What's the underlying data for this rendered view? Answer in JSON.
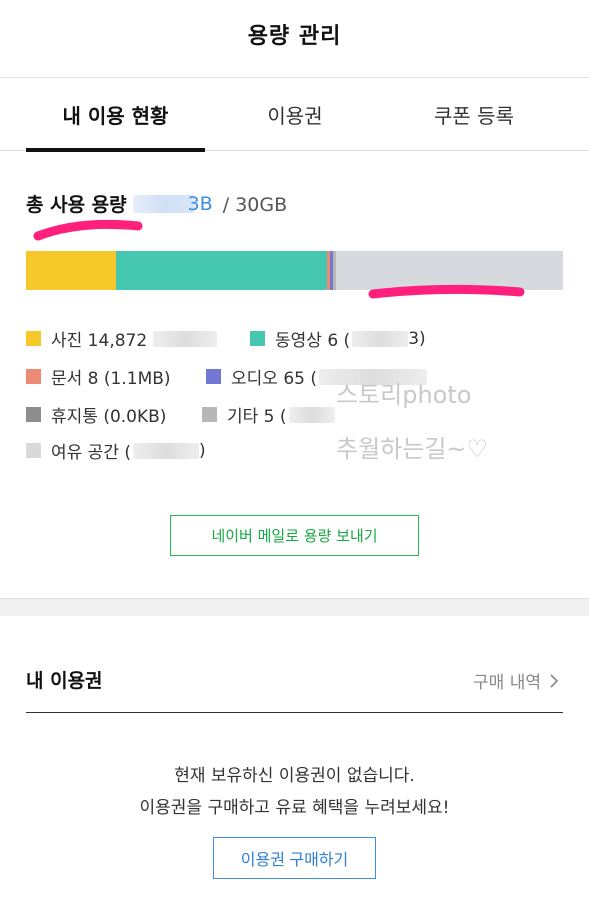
{
  "header": {
    "title": "용량 관리"
  },
  "tabs": [
    {
      "label": "내 이용 현황",
      "active": true
    },
    {
      "label": "이용권",
      "active": false
    },
    {
      "label": "쿠폰 등록",
      "active": false
    }
  ],
  "usage": {
    "label": "총 사용 용량",
    "used_unit_partial": "3B",
    "separator": "/",
    "total": "30GB",
    "accent_color": "#3d8fe0"
  },
  "storage_bar": {
    "segments": [
      {
        "name": "photos",
        "fraction": 0.168,
        "color": "#f7c829"
      },
      {
        "name": "videos",
        "fraction": 0.392,
        "color": "#45c7b0"
      },
      {
        "name": "documents",
        "fraction": 0.006,
        "color": "#ec8a76"
      },
      {
        "name": "audio",
        "fraction": 0.006,
        "color": "#7277d4"
      },
      {
        "name": "other",
        "fraction": 0.006,
        "color": "#b7b7b7"
      }
    ],
    "free_color": "#d6d9de"
  },
  "legend": [
    {
      "label": "사진 14,872",
      "color": "#f7c829"
    },
    {
      "label": "동영상 6 (",
      "suffix": "3)",
      "color": "#45c7b0"
    },
    {
      "label": "문서 8 (1.1MB)",
      "color": "#ec8a76"
    },
    {
      "label": "오디오 65 (",
      "color": "#7277d4"
    },
    {
      "label": "휴지통 (0.0KB)",
      "color": "#8e8e8e"
    },
    {
      "label": "기타 5 (",
      "color": "#b7b7b7"
    },
    {
      "label": "여유 공간 (",
      "suffix": ")",
      "color": "#d9d9d9"
    }
  ],
  "watermark": {
    "line1": "스토리photo",
    "line2": "추월하는길~♡"
  },
  "mail_button": {
    "label": "네이버 메일로 용량 보내기",
    "color": "#1fbf4f"
  },
  "my_pass": {
    "title": "내 이용권",
    "purchase_history_label": "구매 내역",
    "chevron_icon": "chevron-right-icon",
    "empty_line1": "현재 보유하신 이용권이 없습니다.",
    "empty_line2": "이용권을 구매하고 유료 혜택을 누려보세요!",
    "buy_button_label": "이용권 구매하기",
    "buy_color": "#3d8fe0"
  }
}
